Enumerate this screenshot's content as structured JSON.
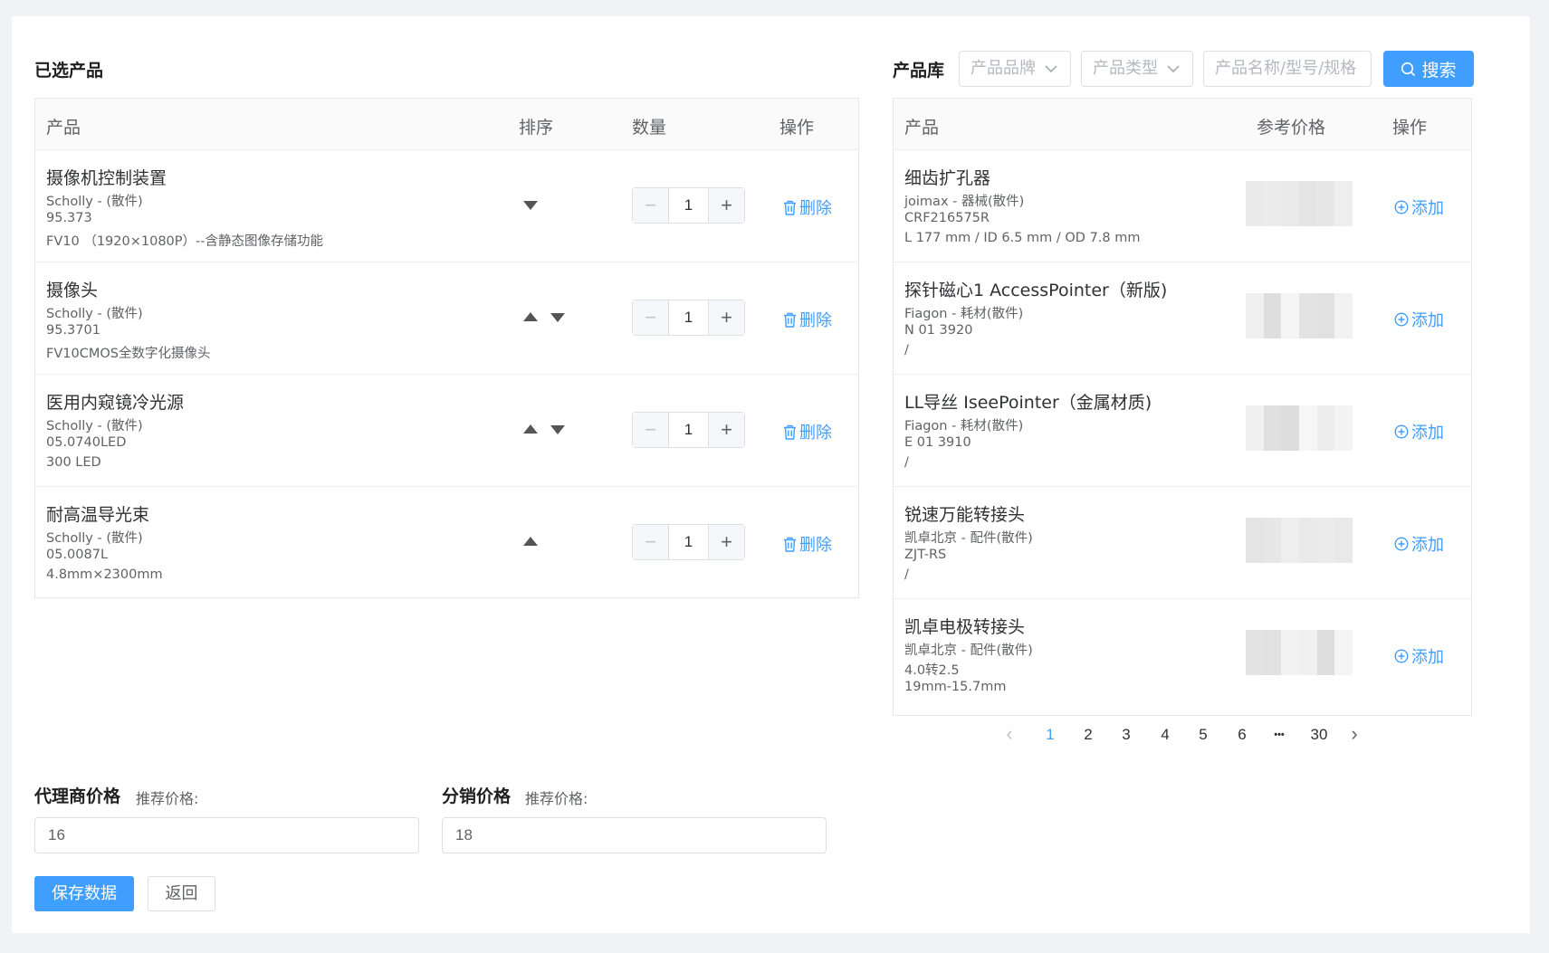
{
  "selected": {
    "title": "已选产品",
    "headers": {
      "product": "产品",
      "sort": "排序",
      "quantity": "数量",
      "action": "操作"
    },
    "rows": [
      {
        "name": "摄像机控制装置",
        "brand": "Scholly - (散件)",
        "model": "95.373",
        "spec": "FV10 （1920×1080P）--含静态图像存储功能",
        "qty": "1",
        "sort_up": false,
        "sort_down": true,
        "delete_label": "删除"
      },
      {
        "name": "摄像头",
        "brand": "Scholly - (散件)",
        "model": "95.3701",
        "spec": "FV10CMOS全数字化摄像头",
        "qty": "1",
        "sort_up": true,
        "sort_down": true,
        "delete_label": "删除"
      },
      {
        "name": "医用内窥镜冷光源",
        "brand": "Scholly - (散件)",
        "model": "05.0740LED",
        "spec": "300 LED",
        "qty": "1",
        "sort_up": true,
        "sort_down": true,
        "delete_label": "删除"
      },
      {
        "name": "耐高温导光束",
        "brand": "Scholly - (散件)",
        "model": "05.0087L",
        "spec": "4.8mm×2300mm",
        "qty": "1",
        "sort_up": true,
        "sort_down": false,
        "delete_label": "删除"
      }
    ]
  },
  "library": {
    "title": "产品库",
    "filters": {
      "brand_placeholder": "产品品牌",
      "type_placeholder": "产品类型",
      "search_placeholder": "产品名称/型号/规格",
      "search_button": "搜索"
    },
    "headers": {
      "product": "产品",
      "price": "参考价格",
      "action": "操作"
    },
    "rows": [
      {
        "name": "细齿扩孔器",
        "brand": "joimax - 器械(散件)",
        "model": "CRF216575R",
        "spec": "L 177 mm / ID 6.5 mm / OD 7.8 mm",
        "add_label": "添加"
      },
      {
        "name": "探针磁心1 AccessPointer（新版)",
        "brand": "Fiagon - 耗材(散件)",
        "model": "N 01 3920",
        "spec": "/",
        "add_label": "添加"
      },
      {
        "name": "LL导丝 IseePointer（金属材质)",
        "brand": "Fiagon - 耗材(散件)",
        "model": "E 01 3910",
        "spec": "/",
        "add_label": "添加"
      },
      {
        "name": "锐速万能转接头",
        "brand": "凯卓北京 - 配件(散件)",
        "model": "ZJT-RS",
        "spec": "/",
        "add_label": "添加"
      },
      {
        "name": "凯卓电极转接头",
        "brand": "凯卓北京 - 配件(散件)",
        "model": "4.0转2.5",
        "spec": "19mm-15.7mm",
        "add_label": "添加"
      }
    ],
    "pagination": {
      "prev": "‹",
      "pages": [
        "1",
        "2",
        "3",
        "4",
        "5",
        "6"
      ],
      "ellipsis": "•••",
      "last": "30",
      "next": "›",
      "current": "1"
    }
  },
  "pricing": {
    "agent_title": "代理商价格",
    "agent_hint": "推荐价格:",
    "agent_value": "16",
    "dist_title": "分销价格",
    "dist_hint": "推荐价格:",
    "dist_value": "18"
  },
  "actions": {
    "save": "保存数据",
    "back": "返回"
  },
  "colors": {
    "primary": "#409eff",
    "border": "#dcdfe6",
    "background": "#f0f2f5"
  }
}
